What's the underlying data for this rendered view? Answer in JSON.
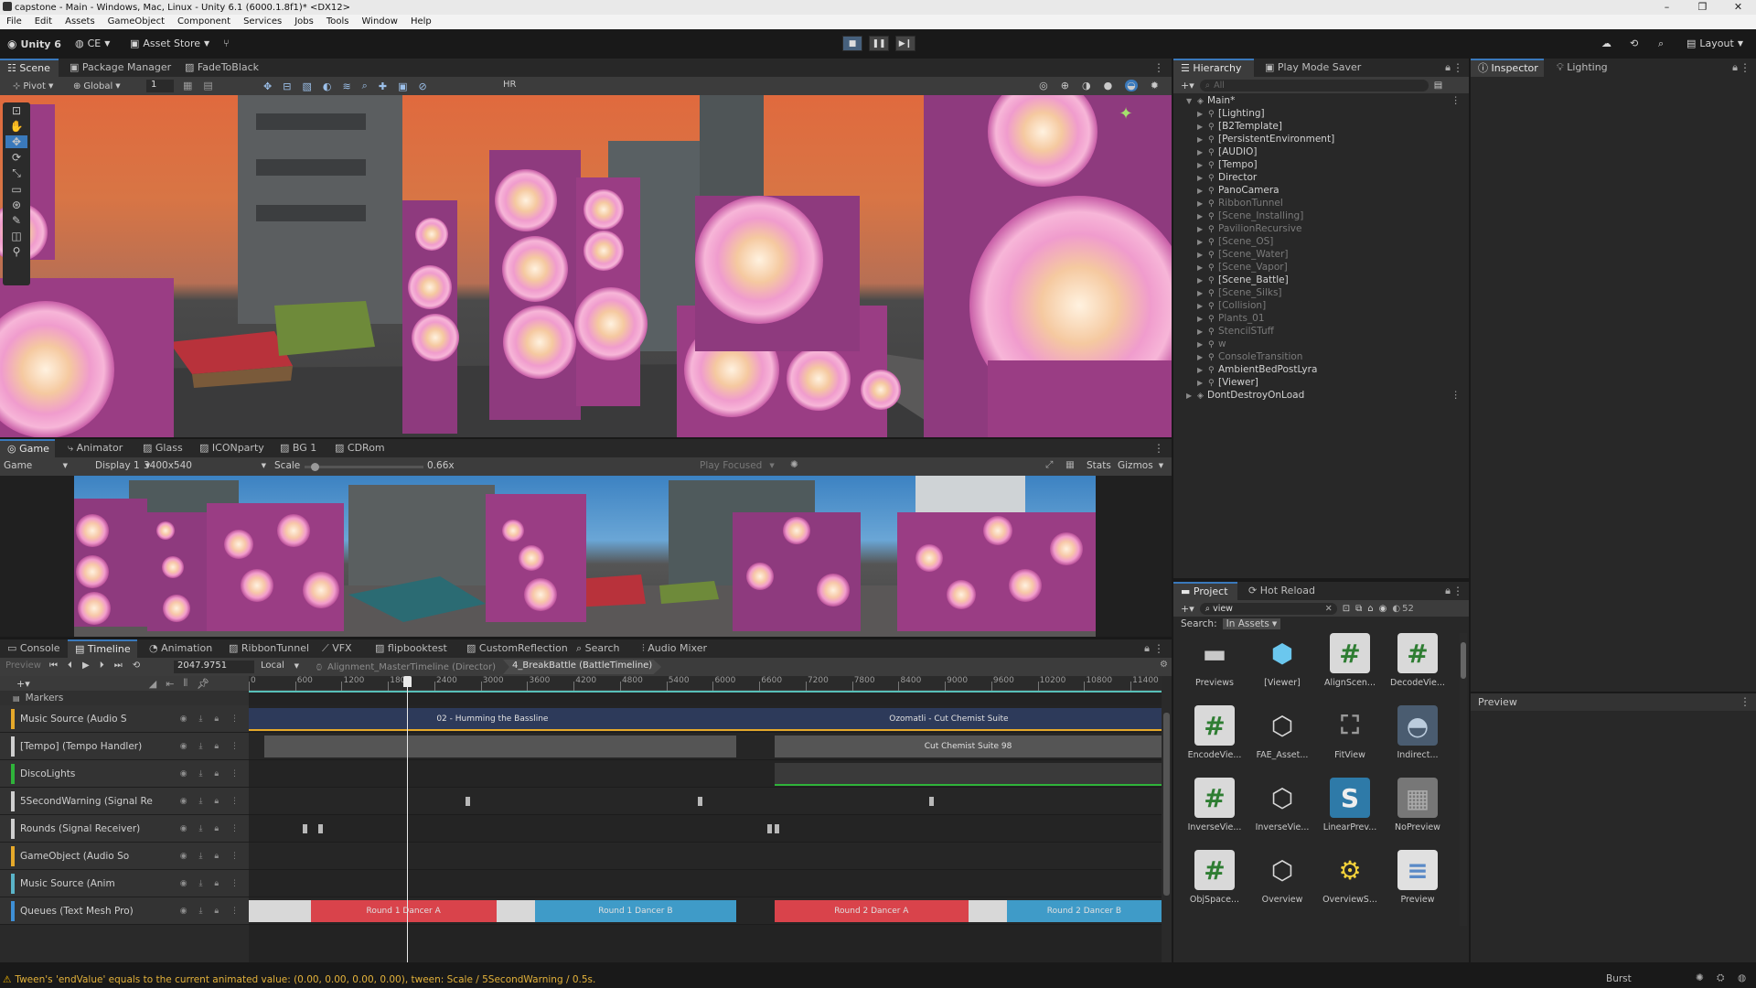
{
  "window": {
    "title": "capstone - Main - Windows, Mac, Linux - Unity 6.1 (6000.1.8f1)* <DX12>"
  },
  "menu": [
    "File",
    "Edit",
    "Assets",
    "GameObject",
    "Component",
    "Services",
    "Jobs",
    "Tools",
    "Window",
    "Help"
  ],
  "toolbar": {
    "unity": "Unity 6",
    "account": "CE",
    "asset_store": "Asset Store",
    "layout": "Layout"
  },
  "scene_tabs": [
    "Scene",
    "Package Manager",
    "FadeToBlack"
  ],
  "scene_toolbar": {
    "pivot": "Pivot",
    "global": "Global",
    "grid": "1",
    "hr": "HR"
  },
  "game_tabs": [
    "Game",
    "Animator",
    "Glass",
    "ICONparty",
    "BG 1",
    "CDRom"
  ],
  "game_toolbar": {
    "game": "Game",
    "display": "Display 1",
    "resolution": "3400x540",
    "scale_label": "Scale",
    "scale_value": "0.66x",
    "play_focused": "Play Focused",
    "stats": "Stats",
    "gizmos": "Gizmos"
  },
  "scale_fraction": 0.05,
  "hierarchy_tabs": [
    "Hierarchy",
    "Play Mode Saver"
  ],
  "inspector_tabs": [
    "Inspector",
    "Lighting"
  ],
  "hierarchy": {
    "root": "Main*",
    "items": [
      {
        "label": "[Lighting]",
        "dim": false
      },
      {
        "label": "[B2Template]",
        "dim": false
      },
      {
        "label": "[PersistentEnvironment]",
        "dim": false
      },
      {
        "label": "[AUDIO]",
        "dim": false
      },
      {
        "label": "[Tempo]",
        "dim": false
      },
      {
        "label": "Director",
        "dim": false
      },
      {
        "label": "PanoCamera",
        "dim": false
      },
      {
        "label": "RibbonTunnel",
        "dim": true
      },
      {
        "label": "[Scene_Installing]",
        "dim": true
      },
      {
        "label": "PavilionRecursive",
        "dim": true
      },
      {
        "label": "[Scene_OS]",
        "dim": true
      },
      {
        "label": "[Scene_Water]",
        "dim": true
      },
      {
        "label": "[Scene_Vapor]",
        "dim": true
      },
      {
        "label": "[Scene_Battle]",
        "dim": false
      },
      {
        "label": "[Scene_Silks]",
        "dim": true
      },
      {
        "label": "[Collision]",
        "dim": true
      },
      {
        "label": "Plants_01",
        "dim": true
      },
      {
        "label": "StencilSTuff",
        "dim": true
      },
      {
        "label": "w",
        "dim": true
      },
      {
        "label": "ConsoleTransition",
        "dim": true
      },
      {
        "label": "AmbientBedPostLyra",
        "dim": false
      },
      {
        "label": "[Viewer]",
        "dim": false
      }
    ],
    "dontdestroy": "DontDestroyOnLoad",
    "search_placeholder": "All"
  },
  "project": {
    "tabs": [
      "Project",
      "Hot Reload"
    ],
    "search_value": "view",
    "search_label": "Search:",
    "search_scope": "In Assets",
    "count": "52",
    "assets": [
      {
        "label": "Previews",
        "icon": "folder-icon"
      },
      {
        "label": "[Viewer]",
        "icon": "cube-icon"
      },
      {
        "label": "AlignScen...",
        "icon": "script-icon"
      },
      {
        "label": "DecodeVie...",
        "icon": "script-icon"
      },
      {
        "label": "EncodeVie...",
        "icon": "script-icon"
      },
      {
        "label": "FAE_Asset...",
        "icon": "prefab-icon"
      },
      {
        "label": "FitView",
        "icon": "fit-icon"
      },
      {
        "label": "Indirect...",
        "icon": "material-icon"
      },
      {
        "label": "InverseVie...",
        "icon": "script-icon"
      },
      {
        "label": "InverseVie...",
        "icon": "prefab-icon"
      },
      {
        "label": "LinearPrev...",
        "icon": "shader-icon"
      },
      {
        "label": "NoPreview",
        "icon": "checker-icon"
      },
      {
        "label": "ObjSpace...",
        "icon": "script-icon"
      },
      {
        "label": "Overview",
        "icon": "prefab-icon"
      },
      {
        "label": "OverviewS...",
        "icon": "settings-icon"
      },
      {
        "label": "Preview",
        "icon": "text-icon"
      }
    ]
  },
  "preview_label": "Preview",
  "bottom_tabs": [
    "Console",
    "Timeline",
    "Animation",
    "RibbonTunnel",
    "VFX",
    "flipbooktest",
    "CustomReflection",
    "Search",
    "Audio Mixer"
  ],
  "timeline": {
    "preview": "Preview",
    "frame": "2047.9751",
    "space": "Local",
    "breadcrumb_1": "Alignment_MasterTimeline (Director)",
    "breadcrumb_2": "4_BreakBattle (BattleTimeline)",
    "markers": "Markers",
    "ruler": [
      "0",
      "600",
      "1200",
      "1800",
      "2400",
      "3000",
      "3600",
      "4200",
      "4800",
      "5400",
      "6000",
      "6600",
      "7200",
      "7800",
      "8400",
      "9000",
      "9600",
      "10200",
      "10800",
      "11400"
    ],
    "playhead": 2047.9751,
    "ruler_max": 11800,
    "tracks": [
      {
        "name": "Music Source (Audio S",
        "color": "#e6a92a"
      },
      {
        "name": "[Tempo] (Tempo Handler)",
        "color": "#cfcfcf"
      },
      {
        "name": "DiscoLights",
        "color": "#2fb33a"
      },
      {
        "name": "5SecondWarning (Signal Re",
        "color": "#cfcfcf"
      },
      {
        "name": "Rounds (Signal Receiver)",
        "color": "#cfcfcf"
      },
      {
        "name": "GameObject (Audio So",
        "color": "#e6a92a"
      },
      {
        "name": "Music Source (Anim",
        "color": "#5ab4c8"
      },
      {
        "name": "Queues (Text Mesh Pro)",
        "color": "#3e8fd6"
      }
    ],
    "clips": {
      "music_1": "02 - Humming the Bassline",
      "music_2": "Ozomatli - Cut Chemist Suite",
      "tempo_2": "Cut Chemist Suite 98",
      "q1": "Round 1 Dancer A",
      "q2": "Round 1 Dancer B",
      "q3": "Round 2 Dancer A",
      "q4": "Round 2 Dancer B"
    }
  },
  "status": {
    "message": "Tween's 'endValue' equals to the current animated value: (0.00, 0.00, 0.00, 0.00), tween: Scale  /  5SecondWarning  /  0.5s.",
    "burst": "Burst"
  },
  "colors": {
    "accent": "#3a79bb",
    "audio": "#e6a92a",
    "signal_green": "#2fb33a",
    "clip_red": "#d9434b",
    "clip_blue": "#3f9bc8"
  }
}
